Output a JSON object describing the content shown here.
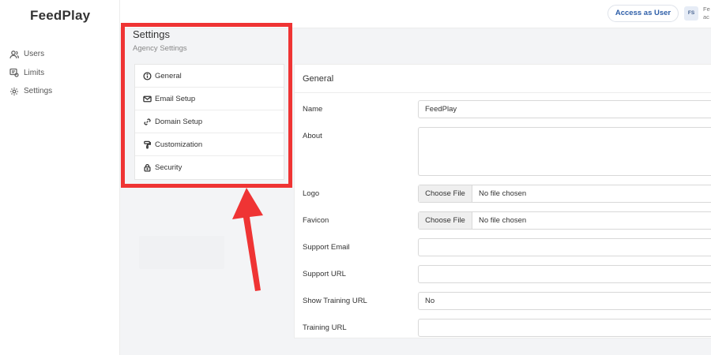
{
  "app": {
    "brand": "FeedPlay"
  },
  "nav": [
    {
      "label": "Users",
      "icon": "users-icon"
    },
    {
      "label": "Limits",
      "icon": "limits-icon"
    },
    {
      "label": "Settings",
      "icon": "gear-icon"
    }
  ],
  "topbar": {
    "access_label": "Access as User",
    "avatar_initials": "FS",
    "user_line1": "Fe",
    "user_line2": "ac"
  },
  "settings": {
    "title": "Settings",
    "subtitle": "Agency Settings",
    "menu": [
      {
        "label": "General",
        "icon": "info-icon"
      },
      {
        "label": "Email Setup",
        "icon": "mail-icon"
      },
      {
        "label": "Domain Setup",
        "icon": "link-icon"
      },
      {
        "label": "Customization",
        "icon": "paint-roller-icon"
      },
      {
        "label": "Security",
        "icon": "lock-icon"
      }
    ]
  },
  "form": {
    "header": "General",
    "name": {
      "label": "Name",
      "value": "FeedPlay"
    },
    "about": {
      "label": "About",
      "value": ""
    },
    "logo": {
      "label": "Logo",
      "button": "Choose File",
      "status": "No file chosen"
    },
    "favicon": {
      "label": "Favicon",
      "button": "Choose File",
      "status": "No file chosen"
    },
    "support_email": {
      "label": "Support Email",
      "value": ""
    },
    "support_url": {
      "label": "Support URL",
      "value": ""
    },
    "show_training_url": {
      "label": "Show Training URL",
      "value": "No"
    },
    "training_url": {
      "label": "Training URL",
      "value": ""
    }
  },
  "colors": {
    "highlight": "#ef3434",
    "accent": "#2d5ea8"
  }
}
